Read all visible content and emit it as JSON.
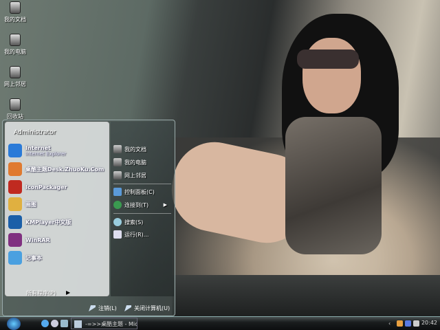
{
  "desktop_icons": [
    {
      "label": "我的文档"
    },
    {
      "label": "我的电脑"
    },
    {
      "label": "网上邻居"
    },
    {
      "label": "回收站"
    }
  ],
  "start_menu": {
    "user": "Administrator",
    "programs": [
      {
        "label": "Internet",
        "sublabel": "Internet Explorer",
        "icon": "internet-explorer-icon",
        "color": "#2a7ad8"
      },
      {
        "label": "桌酷主题Desk.ZhuoKu.Com",
        "icon": "zhuoku-icon",
        "color": "#e07a30"
      },
      {
        "label": "IconPackager",
        "icon": "iconpackager-icon",
        "color": "#c02a20"
      },
      {
        "label": "画图",
        "icon": "paint-icon",
        "color": "#e0b040"
      },
      {
        "label": "KMPlayer中文版",
        "icon": "kmplayer-icon",
        "color": "#1b5fa8"
      },
      {
        "label": "WinRAR",
        "icon": "winrar-icon",
        "color": "#803080"
      },
      {
        "label": "记事本",
        "icon": "notepad-icon",
        "color": "#4aa0e0"
      }
    ],
    "all_programs": "所有程序(P)",
    "right_items": [
      {
        "label": "我的文档"
      },
      {
        "label": "我的电脑"
      },
      {
        "label": "网上邻居"
      },
      {
        "label": "控制面板(C)"
      },
      {
        "label": "连接到(T)"
      },
      {
        "label": "搜索(S)"
      },
      {
        "label": "运行(R)..."
      }
    ],
    "logoff": "注销(L)",
    "shutdown": "关闭计算机(U)"
  },
  "taskbar": {
    "task_label": "-=>>桌酷主题 - Mic...",
    "clock": "20:42"
  }
}
